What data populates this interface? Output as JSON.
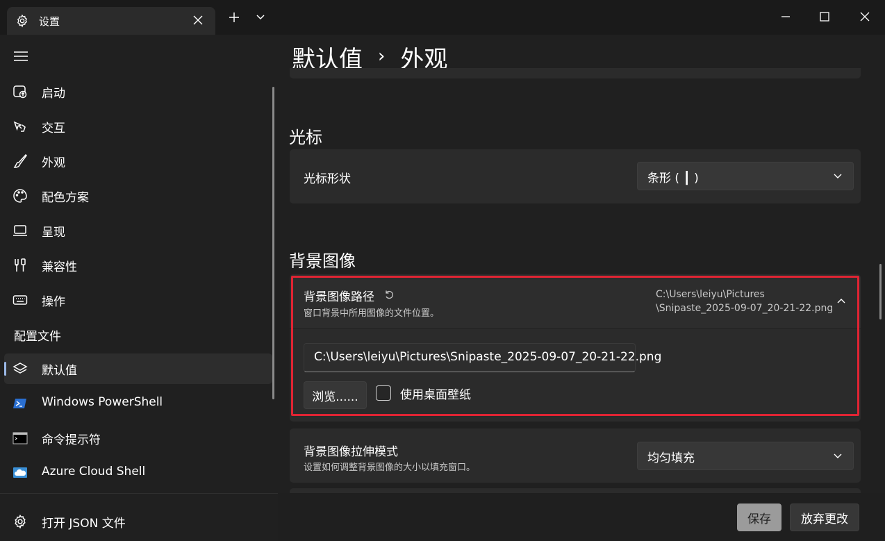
{
  "window": {
    "tab_title": "设置",
    "tab_icon": "gear-icon"
  },
  "sidebar": {
    "items": [
      {
        "label": "启动",
        "icon": "startup-icon"
      },
      {
        "label": "交互",
        "icon": "interaction-icon"
      },
      {
        "label": "外观",
        "icon": "brush-icon"
      },
      {
        "label": "配色方案",
        "icon": "palette-icon"
      },
      {
        "label": "呈现",
        "icon": "laptop-icon"
      },
      {
        "label": "兼容性",
        "icon": "tools-icon"
      },
      {
        "label": "操作",
        "icon": "keyboard-icon"
      }
    ],
    "profiles_header": "配置文件",
    "profiles": [
      {
        "label": "默认值",
        "icon": "layers-icon"
      },
      {
        "label": "Windows PowerShell",
        "icon": "powershell-icon"
      },
      {
        "label": "命令提示符",
        "icon": "cmd-icon"
      },
      {
        "label": "Azure Cloud Shell",
        "icon": "azure-icon"
      }
    ],
    "open_json": "打开 JSON 文件"
  },
  "main": {
    "breadcrumb_parent": "默认值",
    "breadcrumb_sep": "›",
    "breadcrumb_current": "外观",
    "cursor_section": "光标",
    "cursor_shape_label": "光标形状",
    "cursor_shape_value": "条形 ( ┃ )",
    "bg_section": "背景图像",
    "bg_path_title": "背景图像路径",
    "bg_path_desc": "窗口背景中所用图像的文件位置。",
    "bg_path_summary_line1": "C:\\Users\\leiyu\\Pictures",
    "bg_path_summary_line2": "\\Snipaste_2025-09-07_20-21-22.png",
    "bg_path_value": "C:\\Users\\leiyu\\Pictures\\Snipaste_2025-09-07_20-21-22.png",
    "browse_label": "浏览......",
    "use_wallpaper_label": "使用桌面壁纸",
    "use_wallpaper_checked": false,
    "stretch_title": "背景图像拉伸模式",
    "stretch_desc": "设置如何调整背景图像的大小以填充窗口。",
    "stretch_value": "均匀填充"
  },
  "footer": {
    "save_label": "保存",
    "discard_label": "放弃更改"
  },
  "colors": {
    "background": "#202020",
    "card": "#2b2b2b",
    "highlight": "#e02433",
    "accent": "#9ab8e6"
  }
}
